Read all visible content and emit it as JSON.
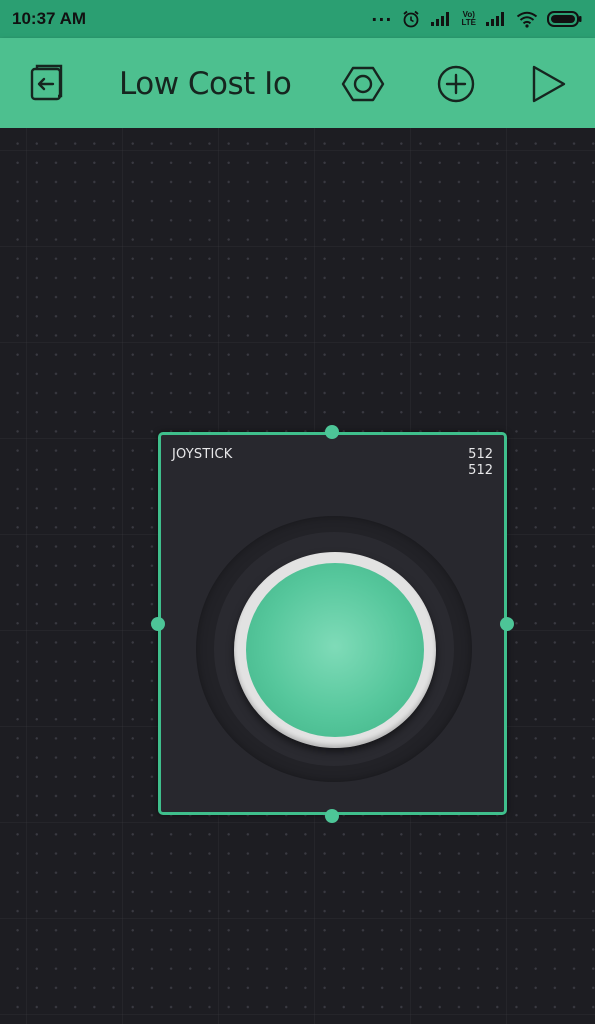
{
  "status_bar": {
    "time": "10:37 AM",
    "dots": "...",
    "volte_line1": "Vo)",
    "volte_line2": "LTE",
    "icons": [
      "alarm-icon",
      "signal-icon",
      "volte-icon",
      "signal-icon",
      "wifi-icon",
      "battery-icon"
    ]
  },
  "toolbar": {
    "title": "Low Cost Io",
    "back_icon": "exit-project-icon",
    "settings_icon": "hexagon-nut-icon",
    "add_icon": "add-circle-icon",
    "play_icon": "play-icon"
  },
  "widget": {
    "title": "JOYSTICK",
    "x_value": "512",
    "y_value": "512"
  },
  "colors": {
    "status_bar": "#2b9f72",
    "toolbar": "#4dc08f",
    "canvas": "#1d1d22",
    "widget_border": "#3fbf8c",
    "knob": "#56c79c"
  }
}
